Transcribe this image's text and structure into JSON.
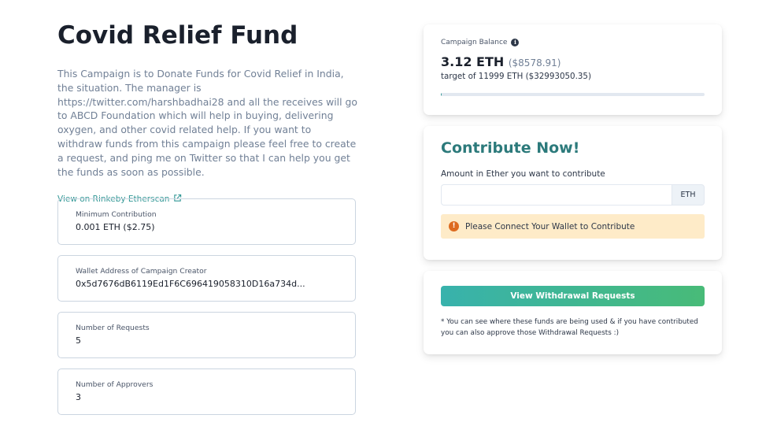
{
  "campaign": {
    "title": "Covid Relief Fund",
    "description": "This Campaign is to Donate Funds for Covid Relief in India, the situation. The manager is https://twitter.com/harshbadhai28 and all the receives will go to ABCD Foundation which will help in buying, delivering oxygen, and other covid related help. If you want to withdraw funds from this campaign please feel free to create a request, and ping me on Twitter so that I can help you get the funds as soon as possible.",
    "etherscan_link": "View on Rinkeby Etherscan"
  },
  "stats": [
    {
      "label": "Minimum Contribution",
      "value": "0.001 ETH ($2.75)"
    },
    {
      "label": "Wallet Address of Campaign Creator",
      "value": "0x5d7676dB6119Ed1F6C696419058310D16a734d..."
    },
    {
      "label": "Number of Requests",
      "value": "5"
    },
    {
      "label": "Number of Approvers",
      "value": "3"
    }
  ],
  "balance": {
    "label": "Campaign Balance",
    "amount": "3.12 ETH",
    "usd": "($8578.91)",
    "target": "target of 11999 ETH ($32993050.35)",
    "progress_fraction": 0.00026
  },
  "contribute": {
    "heading": "Contribute Now!",
    "amount_label": "Amount in Ether you want to contribute",
    "input_value": "",
    "unit": "ETH",
    "alert": "Please Connect Your Wallet to Contribute"
  },
  "withdraw": {
    "button": "View Withdrawal Requests",
    "note": "* You can see where these funds are being used & if you have contributed you can also approve those Withdrawal Requests :)"
  },
  "colors": {
    "accent_teal": "#319795",
    "heading_teal": "#2c7a7b",
    "alert_bg": "#feebc8",
    "warn_orange": "#dd6b20"
  }
}
